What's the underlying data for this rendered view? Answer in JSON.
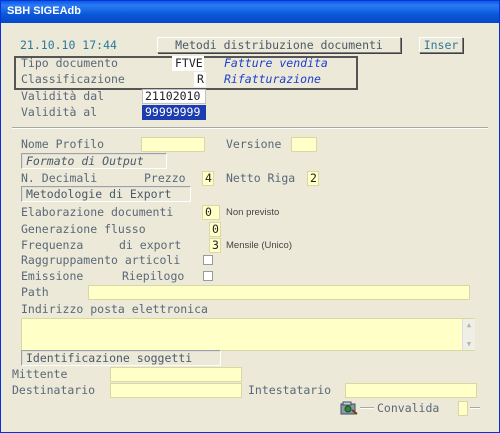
{
  "window": {
    "title": "SBH SIGEAdb"
  },
  "header": {
    "datetime": "21.10.10 17:44",
    "section_title": "Metodi distribuzione documenti",
    "mode": "Inser"
  },
  "document": {
    "tipo_label": "Tipo documento",
    "tipo_code": "FTVE",
    "tipo_desc": "Fatture vendita",
    "class_label": "Classificazione",
    "class_code": "R",
    "class_desc": "Rifatturazione"
  },
  "validity": {
    "from_label": "Validità dal",
    "from_value": "21102010",
    "to_label": "Validità  al",
    "to_value": "99999999"
  },
  "profile": {
    "name_label": "Nome Profilo",
    "name_value": "",
    "version_label": "Versione",
    "version_value": ""
  },
  "output": {
    "section": "Formato di Output",
    "decimals_label": "N.  Decimali",
    "price_label": "Prezzo",
    "price_value": "4",
    "net_label": "Netto Riga",
    "net_value": "2"
  },
  "export": {
    "section": "Metodologie di Export",
    "elab_label": "Elaborazione documenti",
    "elab_value": "0",
    "elab_note": "Non previsto",
    "gen_label": "Generazione  flusso",
    "gen_value": "0",
    "freq_label": "Frequenza",
    "freq_label2": "di export",
    "freq_value": "3",
    "freq_note": "Mensile (Unico)",
    "group_label": "Raggruppamento articoli",
    "summary_label": "Emissione",
    "summary_label2": "Riepilogo",
    "path_label": "Path",
    "path_value": "",
    "email_label": "Indirizzo posta elettronica",
    "email_value": ""
  },
  "subjects": {
    "section": "Identificazione soggetti",
    "sender_label": "Mittente",
    "sender_value": "",
    "recipient_label": "Destinatario",
    "recipient_value": "",
    "holder_label": "Intestatario",
    "holder_value": ""
  },
  "footer": {
    "tool_icon": "tools-icon",
    "confirm_label": "Convalida",
    "confirm_value": ""
  }
}
